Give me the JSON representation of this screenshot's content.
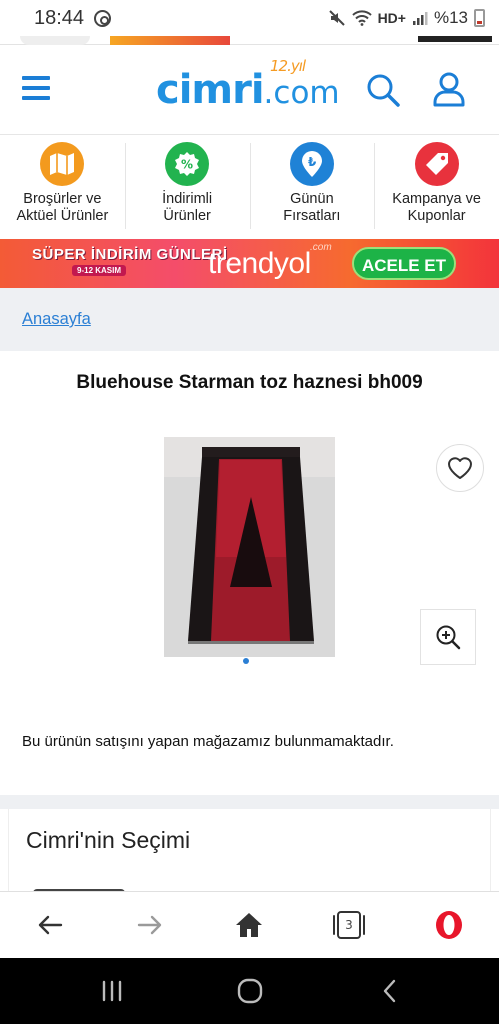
{
  "status_bar": {
    "time": "18:44",
    "network": "HD+",
    "battery": "%13"
  },
  "header": {
    "logo": "cimri",
    "logo_suffix": ".com",
    "logo_badge": "12.yıl",
    "accent_color": "#2191e0"
  },
  "categories": [
    {
      "label_line1": "Broşürler ve",
      "label_line2": "Aktüel Ürünler",
      "icon": "map-icon",
      "color": "#f39a1e"
    },
    {
      "label_line1": "İndirimli",
      "label_line2": "Ürünler",
      "icon": "percent-icon",
      "color": "#22b34f"
    },
    {
      "label_line1": "Günün",
      "label_line2": "Fırsatları",
      "icon": "lira-icon",
      "color": "#1f82d6"
    },
    {
      "label_line1": "Kampanya ve",
      "label_line2": "Kuponlar",
      "icon": "tag-icon",
      "color": "#e8323d"
    }
  ],
  "banner": {
    "left_text": "SÜPER İNDİRİM GÜNLERİ",
    "left_sub": "9-12 KASIM",
    "brand": "trendyol",
    "brand_suffix": ".com",
    "cta": "ACELE ET"
  },
  "breadcrumb": {
    "home": "Anasayfa"
  },
  "product": {
    "title": "Bluehouse Starman toz haznesi bh009",
    "unavailable_note": "Bu ürünün satışını yapan mağazamız bulunmamaktadır.",
    "image_count": 1
  },
  "picks": {
    "heading": "Cimri'nin Seçimi"
  },
  "browser_toolbar": {
    "tab_count": "3"
  }
}
